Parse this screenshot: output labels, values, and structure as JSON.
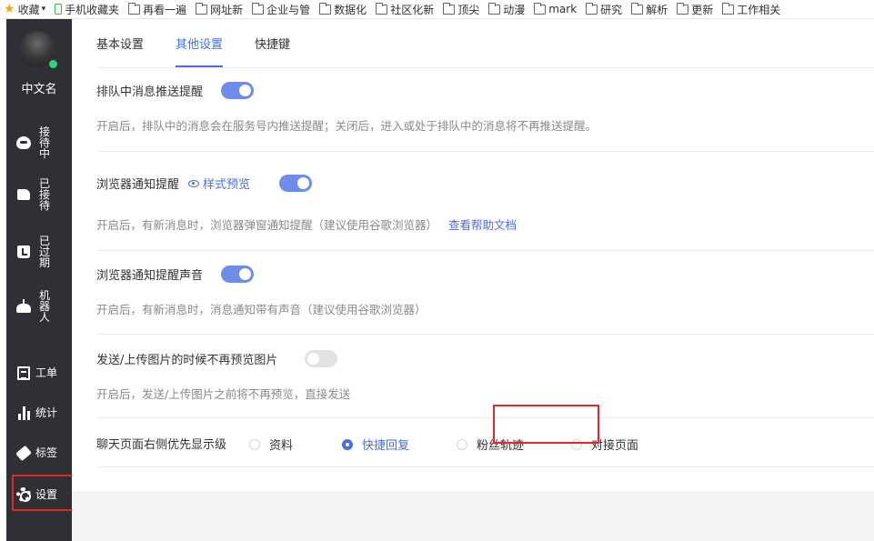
{
  "bookmarks": [
    {
      "label": "收藏",
      "icon": "star-icon"
    },
    {
      "label": "手机收藏夹",
      "icon": "phone-icon"
    },
    {
      "label": "再看一遍",
      "icon": "folder-icon"
    },
    {
      "label": "网址新",
      "icon": "folder-icon"
    },
    {
      "label": "企业与管",
      "icon": "folder-icon"
    },
    {
      "label": "数据化",
      "icon": "folder-icon"
    },
    {
      "label": "社区化新",
      "icon": "folder-icon"
    },
    {
      "label": "顶尖",
      "icon": "folder-icon"
    },
    {
      "label": "动漫",
      "icon": "folder-icon"
    },
    {
      "label": "mark",
      "icon": "folder-icon"
    },
    {
      "label": "研究",
      "icon": "folder-icon"
    },
    {
      "label": "解析",
      "icon": "folder-icon"
    },
    {
      "label": "更新",
      "icon": "folder-icon"
    },
    {
      "label": "工作相关",
      "icon": "folder-icon"
    }
  ],
  "sidebar": {
    "user_name": "中文名",
    "online": true,
    "items": [
      {
        "label": "接待中",
        "icon": "headset-icon"
      },
      {
        "label": "已接待",
        "icon": "thumb-icon"
      },
      {
        "label": "已过期",
        "icon": "expired-icon"
      },
      {
        "label": "机器人",
        "icon": "robot-icon"
      },
      {
        "label": "工单",
        "icon": "ticket-icon"
      },
      {
        "label": "统计",
        "icon": "bar-chart-icon"
      },
      {
        "label": "标签",
        "icon": "tag-icon"
      },
      {
        "label": "设置",
        "icon": "gear-icon",
        "active": true
      }
    ]
  },
  "tabs": [
    {
      "label": "基本设置",
      "active": false
    },
    {
      "label": "其他设置",
      "active": true
    },
    {
      "label": "快捷键",
      "active": false
    }
  ],
  "settings": [
    {
      "title": "排队中消息推送提醒",
      "enabled": true,
      "desc": "开启后，排队中的消息会在服务号内推送提醒；关闭后，进入或处于排队中的消息将不再推送提醒。"
    },
    {
      "title": "浏览器通知提醒",
      "preview_label": "样式预览",
      "enabled": true,
      "desc": "开启后，有新消息时，浏览器弹窗通知提醒（建议使用谷歌浏览器）",
      "help_link": "查看帮助文档"
    },
    {
      "title": "浏览器通知提醒声音",
      "enabled": true,
      "desc": "开启后，有新消息时，消息通知带有声音（建议使用谷歌浏览器）"
    },
    {
      "title": "发送/上传图片的时候不再预览图片",
      "enabled": false,
      "desc": "开启后，发送/上传图片之前将不再预览，直接发送"
    }
  ],
  "priority": {
    "title": "聊天页面右侧优先显示级",
    "options": [
      {
        "label": "资料",
        "checked": false
      },
      {
        "label": "快捷回复",
        "checked": true
      },
      {
        "label": "粉丝轨迹",
        "checked": false
      },
      {
        "label": "对接页面",
        "checked": false
      }
    ]
  },
  "colors": {
    "accent": "#4a6ee0",
    "toggle_on": "#6f8ce8",
    "sidebar_bg": "#2f3035",
    "highlight_box": "#e3262a"
  }
}
